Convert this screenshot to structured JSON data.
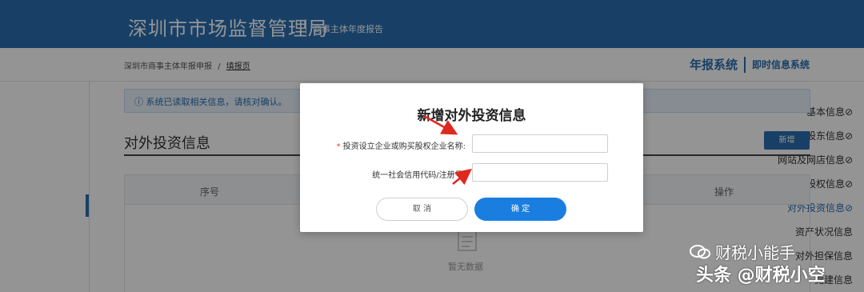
{
  "header": {
    "title": "深圳市市场监督管理局",
    "subtitle": "商事主体年度报告"
  },
  "breadcrumb": {
    "root": "深圳市商事主体年报申报",
    "separator": "/",
    "current": "填报页"
  },
  "system_nav": {
    "annual_report": "年报系统",
    "instant_info": "即时信息系统"
  },
  "sidebar": {
    "items": [
      {
        "label": "基本信息⊘"
      },
      {
        "label": "股东信息⊘"
      },
      {
        "label": "网站及网店信息⊘"
      },
      {
        "label": "股权信息⊘"
      },
      {
        "label": "对外投资信息⊘"
      },
      {
        "label": "资产状况信息"
      },
      {
        "label": "对外担保信息"
      },
      {
        "label": "党建信息"
      }
    ],
    "active_index": 4
  },
  "notice": {
    "icon": "info-circle-icon",
    "text": "ⓘ 系统已读取相关信息，请核对确认。"
  },
  "section": {
    "title": "对外投资信息",
    "add_label": "新增"
  },
  "table": {
    "columns": [
      "序号",
      "操作"
    ],
    "empty_icon": "empty-box-icon",
    "empty_text": "暂无数据"
  },
  "modal": {
    "title": "新增对外投资信息",
    "field1_label": "投资设立企业或购买股权企业名称:",
    "field1_required": "*",
    "field1_value": "",
    "field2_label": "统一社会信用代码/注册号:",
    "field2_value": "",
    "cancel_label": "取 消",
    "ok_label": "确 定"
  },
  "watermark": {
    "line1": "财税小能手",
    "line2": "头条 @财税小空",
    "icon": "wechat-icon"
  },
  "colors": {
    "brand": "#2a6fb0",
    "primary_button": "#1a7ee0",
    "arrow": "#e0281e"
  }
}
